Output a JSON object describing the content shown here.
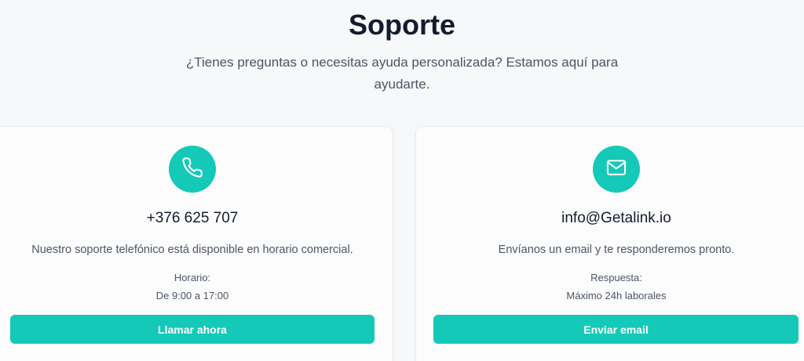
{
  "header": {
    "title": "Soporte",
    "subtitle": "¿Tienes preguntas o necesitas ayuda personalizada? Estamos aquí para ayudarte."
  },
  "theme": {
    "accent": "#14c9b7",
    "background": "#f6f8fa",
    "card": "#fcfcfd"
  },
  "cards": [
    {
      "icon": "phone-icon",
      "contact": "+376 625 707",
      "description": "Nuestro soporte telefónico está disponible en horario comercial.",
      "meta_label": "Horario:",
      "meta_value": "De 9:00 a 17:00",
      "button_label": "Llamar ahora"
    },
    {
      "icon": "mail-icon",
      "contact": "info@Getalink.io",
      "description": "Envíanos un email y te responderemos pronto.",
      "meta_label": "Respuesta:",
      "meta_value": "Máximo 24h laborales",
      "button_label": "Enviar email"
    }
  ]
}
